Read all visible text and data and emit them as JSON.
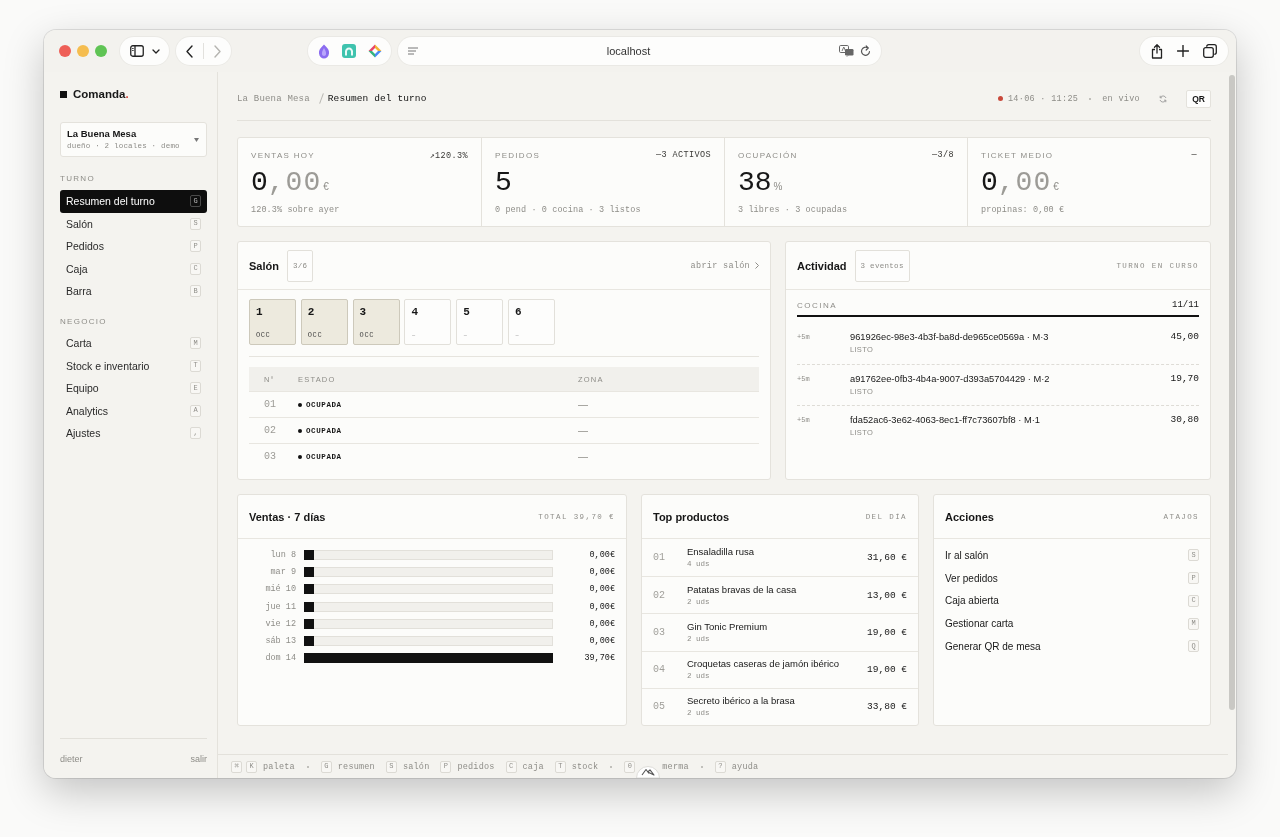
{
  "browser": {
    "url": "localhost",
    "back_disabled": false,
    "forward_disabled": true
  },
  "sidebar": {
    "brand": {
      "name": "Comanda",
      "suffix": "."
    },
    "workspace": {
      "name": "La Buena Mesa",
      "detail": "dueño · 2 locales · demo"
    },
    "sections": [
      {
        "title": "TURNO",
        "items": [
          {
            "label": "Resumen del turno",
            "key": "G",
            "selected": true
          },
          {
            "label": "Salón",
            "key": "S",
            "selected": false
          },
          {
            "label": "Pedidos",
            "key": "P",
            "selected": false
          },
          {
            "label": "Caja",
            "key": "C",
            "selected": false
          },
          {
            "label": "Barra",
            "key": "B",
            "selected": false
          }
        ]
      },
      {
        "title": "NEGOCIO",
        "items": [
          {
            "label": "Carta",
            "key": "M",
            "selected": false
          },
          {
            "label": "Stock e inventario",
            "key": "T",
            "selected": false
          },
          {
            "label": "Equipo",
            "key": "E",
            "selected": false
          },
          {
            "label": "Analytics",
            "key": "A",
            "selected": false
          },
          {
            "label": "Ajustes",
            "key": ",",
            "selected": false
          }
        ]
      }
    ],
    "user": {
      "name": "dieter",
      "action": "salir"
    }
  },
  "header": {
    "breadcrumb": [
      "La Buena Mesa",
      "Resumen del turno"
    ],
    "live": true,
    "timestamp": "14·06 · 11:25",
    "status": "en vivo",
    "qr_button": "QR"
  },
  "kpis": [
    {
      "label": "VENTAS HOY",
      "delta": "↗120.3%",
      "value": "0",
      "decimals": ",00",
      "unit": "€",
      "note": "120.3% sobre ayer"
    },
    {
      "label": "PEDIDOS",
      "delta": "—3 ACTIVOS",
      "value": "5",
      "note": "0 pend · 0 cocina · 3 listos"
    },
    {
      "label": "OCUPACIÓN",
      "delta": "—3/8",
      "value": "38",
      "unit": "%",
      "note": "3 libres · 3 ocupadas"
    },
    {
      "label": "TICKET MEDIO",
      "delta": "—",
      "value": "0",
      "decimals": ",00",
      "unit": "€",
      "note": "propinas: 0,00 €"
    }
  ],
  "salon": {
    "title": "Salón",
    "count": "3/6",
    "link": "abrir salón",
    "tables": [
      {
        "number": "1",
        "status": "OCC",
        "occupied": true
      },
      {
        "number": "2",
        "status": "OCC",
        "occupied": true
      },
      {
        "number": "3",
        "status": "OCC",
        "occupied": true
      },
      {
        "number": "4",
        "status": "–",
        "occupied": false
      },
      {
        "number": "5",
        "status": "–",
        "occupied": false
      },
      {
        "number": "6",
        "status": "–",
        "occupied": false
      }
    ],
    "columns": [
      "N°",
      "ESTADO",
      "ZONA"
    ],
    "rows": [
      {
        "number": "01",
        "status": "OCUPADA",
        "zone": "—"
      },
      {
        "number": "02",
        "status": "OCUPADA",
        "zone": "—"
      },
      {
        "number": "03",
        "status": "OCUPADA",
        "zone": "—"
      }
    ]
  },
  "activity": {
    "title": "Actividad",
    "count": "3 eventos",
    "scope": "TURNO EN CURSO",
    "group": {
      "label": "COCINA",
      "count": "11/11"
    },
    "events": [
      {
        "time": "+5m",
        "title": "961926ec-98e3-4b3f-ba8d-de965ce0569a · M·3",
        "status": "LISTO",
        "amount": "45,00"
      },
      {
        "time": "+5m",
        "title": "a91762ee-0fb3-4b4a-9007-d393a5704429 · M·2",
        "status": "LISTO",
        "amount": "19,70"
      },
      {
        "time": "+5m",
        "title": "fda52ac6-3e62-4063-8ec1-ff7c73607bf8 · M·1",
        "status": "LISTO",
        "amount": "30,80"
      }
    ]
  },
  "sales": {
    "title": "Ventas · 7 días",
    "total": "TOTAL 39,70 €",
    "chart_data": {
      "type": "bar",
      "orientation": "horizontal",
      "categories": [
        "lun 8",
        "mar 9",
        "mié 10",
        "jue 11",
        "vie 12",
        "sáb 13",
        "dom 14"
      ],
      "values": [
        0,
        0,
        0,
        0,
        0,
        0,
        39.7
      ],
      "data_labels": true,
      "value_labels": [
        "0,00€",
        "0,00€",
        "0,00€",
        "0,00€",
        "0,00€",
        "0,00€",
        "39,70€"
      ]
    }
  },
  "top_products": {
    "title": "Top productos",
    "scope": "DEL DÍA",
    "items": [
      {
        "rank": "01",
        "name": "Ensaladilla rusa",
        "qty": "4 uds",
        "amount": "31,60 €"
      },
      {
        "rank": "02",
        "name": "Patatas bravas de la casa",
        "qty": "2 uds",
        "amount": "13,00 €"
      },
      {
        "rank": "03",
        "name": "Gin Tonic Premium",
        "qty": "2 uds",
        "amount": "19,00 €"
      },
      {
        "rank": "04",
        "name": "Croquetas caseras de jamón ibérico",
        "qty": "2 uds",
        "amount": "19,00 €"
      },
      {
        "rank": "05",
        "name": "Secreto ibérico a la brasa",
        "qty": "2 uds",
        "amount": "33,80 €"
      }
    ]
  },
  "actions": {
    "title": "Acciones",
    "scope": "ATAJOS",
    "items": [
      {
        "label": "Ir al salón",
        "key": "S"
      },
      {
        "label": "Ver pedidos",
        "key": "P"
      },
      {
        "label": "Caja abierta",
        "key": "C"
      },
      {
        "label": "Gestionar carta",
        "key": "M"
      },
      {
        "label": "Generar QR de mesa",
        "key": "Q"
      }
    ]
  },
  "footer": {
    "shortcut_groups": [
      [
        {
          "keys": [
            "⌘",
            "K"
          ],
          "label": "paleta",
          "overlay": false
        }
      ],
      [
        {
          "keys": [
            "G"
          ],
          "label": "resumen",
          "overlay": false
        },
        {
          "keys": [
            "S"
          ],
          "label": "salón",
          "overlay": false
        },
        {
          "keys": [
            "P"
          ],
          "label": "pedidos",
          "overlay": false
        },
        {
          "keys": [
            "C"
          ],
          "label": "caja",
          "overlay": false
        },
        {
          "keys": [
            "T"
          ],
          "label": "stock",
          "overlay": false
        }
      ],
      [
        {
          "keys": [
            "0"
          ],
          "label": "merma",
          "overlay": true
        }
      ],
      [
        {
          "keys": [
            "?"
          ],
          "label": "ayuda",
          "overlay": false
        }
      ]
    ]
  }
}
